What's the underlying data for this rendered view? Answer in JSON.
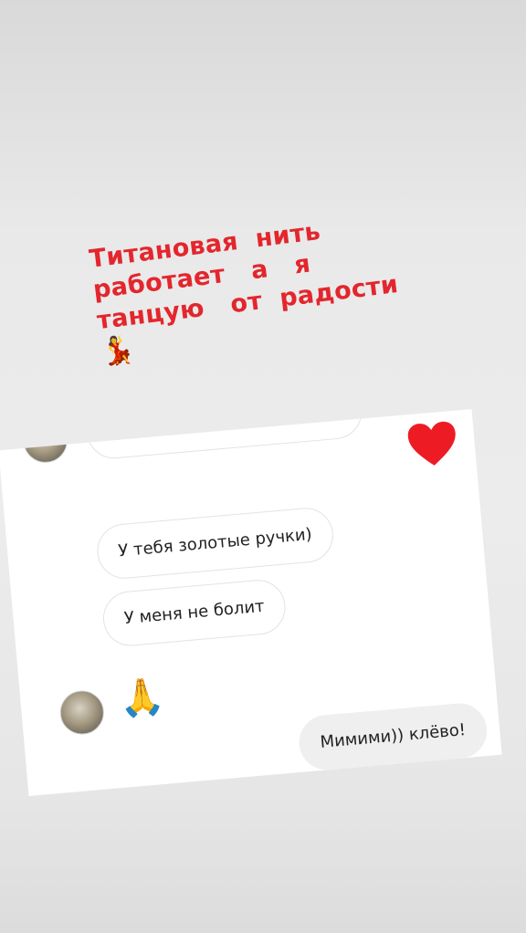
{
  "caption": {
    "line1": "Титановая  нить",
    "line2": "работает   а   я",
    "line3": "танцую   от  радости",
    "emoji": "💃"
  },
  "chat": {
    "messages": [
      {
        "text": "У тебя золотые ручки)",
        "from": "other"
      },
      {
        "text": "У меня не болит",
        "from": "other"
      },
      {
        "text": "🙏",
        "from": "other"
      },
      {
        "text": "Мимими)) клёво!",
        "from": "me"
      }
    ],
    "heart_color": "#ed1c24"
  },
  "colors": {
    "caption": "#e3262d",
    "bubble_border": "#e3e3e3",
    "my_bubble": "#efefef"
  }
}
